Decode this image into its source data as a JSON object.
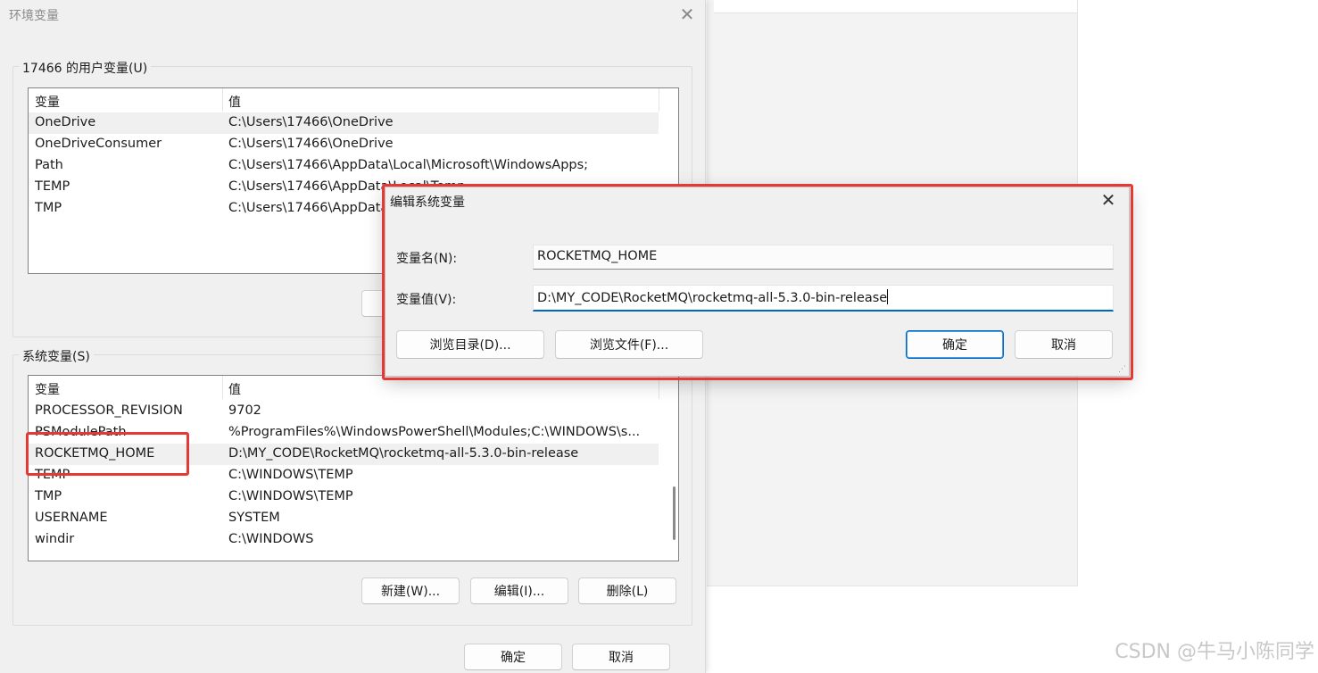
{
  "env_window": {
    "title": "环境变量",
    "user_group_label": "17466 的用户变量(U)",
    "system_group_label": "系统变量(S)",
    "ok_label": "确定",
    "cancel_label": "取消"
  },
  "user_vars": {
    "col_name": "变量",
    "col_value": "值",
    "rows": [
      {
        "name": "OneDrive",
        "value": "C:\\Users\\17466\\OneDrive"
      },
      {
        "name": "OneDriveConsumer",
        "value": "C:\\Users\\17466\\OneDrive"
      },
      {
        "name": "Path",
        "value": "C:\\Users\\17466\\AppData\\Local\\Microsoft\\WindowsApps;"
      },
      {
        "name": "TEMP",
        "value": "C:\\Users\\17466\\AppData\\Local\\Temp"
      },
      {
        "name": "TMP",
        "value": "C:\\Users\\17466\\AppData\\Local\\Temp"
      }
    ]
  },
  "system_vars": {
    "col_name": "变量",
    "col_value": "值",
    "rows": [
      {
        "name": "PROCESSOR_REVISION",
        "value": "9702"
      },
      {
        "name": "PSModulePath",
        "value": "%ProgramFiles%\\WindowsPowerShell\\Modules;C:\\WINDOWS\\s..."
      },
      {
        "name": "ROCKETMQ_HOME",
        "value": "D:\\MY_CODE\\RocketMQ\\rocketmq-all-5.3.0-bin-release"
      },
      {
        "name": "TEMP",
        "value": "C:\\WINDOWS\\TEMP"
      },
      {
        "name": "TMP",
        "value": "C:\\WINDOWS\\TEMP"
      },
      {
        "name": "USERNAME",
        "value": "SYSTEM"
      },
      {
        "name": "windir",
        "value": "C:\\WINDOWS"
      }
    ],
    "new_label": "新建(W)...",
    "edit_label": "编辑(I)...",
    "delete_label": "删除(L)"
  },
  "edit_dialog": {
    "title": "编辑系统变量",
    "name_label": "变量名(N):",
    "value_label": "变量值(V):",
    "name_value": "ROCKETMQ_HOME",
    "value_value": "D:\\MY_CODE\\RocketMQ\\rocketmq-all-5.3.0-bin-release",
    "browse_dir_label": "浏览目录(D)...",
    "browse_file_label": "浏览文件(F)...",
    "ok_label": "确定",
    "cancel_label": "取消"
  },
  "watermark": "CSDN @牛马小陈同学",
  "colors": {
    "highlight_red": "#e53935",
    "accent_blue": "#0067c0"
  }
}
